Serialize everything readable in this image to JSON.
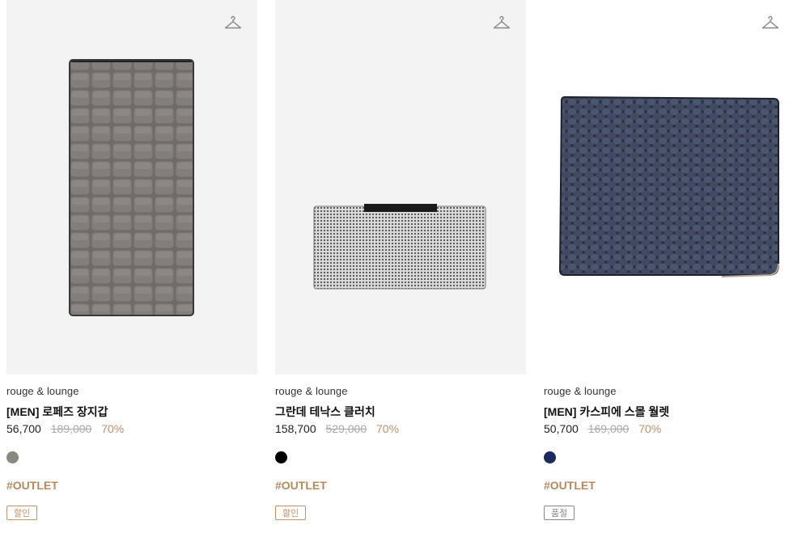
{
  "products": [
    {
      "brand": "rouge & lounge",
      "name": "[MEN] 로페즈 장지갑",
      "price": "56,700",
      "original_price": "189,000",
      "discount": "70%",
      "color_swatch": "#8a8880",
      "tag": "#OUTLET",
      "badge": "할인",
      "badge_color": "#c0916b",
      "image": "gray-croc-long-wallet",
      "icon": "hanger-icon"
    },
    {
      "brand": "rouge & lounge",
      "name": "그란데 테낙스 클러치",
      "price": "158,700",
      "original_price": "529,000",
      "discount": "70%",
      "color_swatch": "#000000",
      "tag": "#OUTLET",
      "badge": "할인",
      "badge_color": "#c0916b",
      "image": "silver-mesh-clutch",
      "icon": "hanger-icon"
    },
    {
      "brand": "rouge & lounge",
      "name": "[MEN] 카스피에 스몰 월렛",
      "price": "50,700",
      "original_price": "169,000",
      "discount": "70%",
      "color_swatch": "#1c2a5e",
      "tag": "#OUTLET",
      "badge": "품절",
      "badge_color": "#888888",
      "image": "navy-snake-bifold-wallet",
      "icon": "hanger-icon"
    }
  ]
}
